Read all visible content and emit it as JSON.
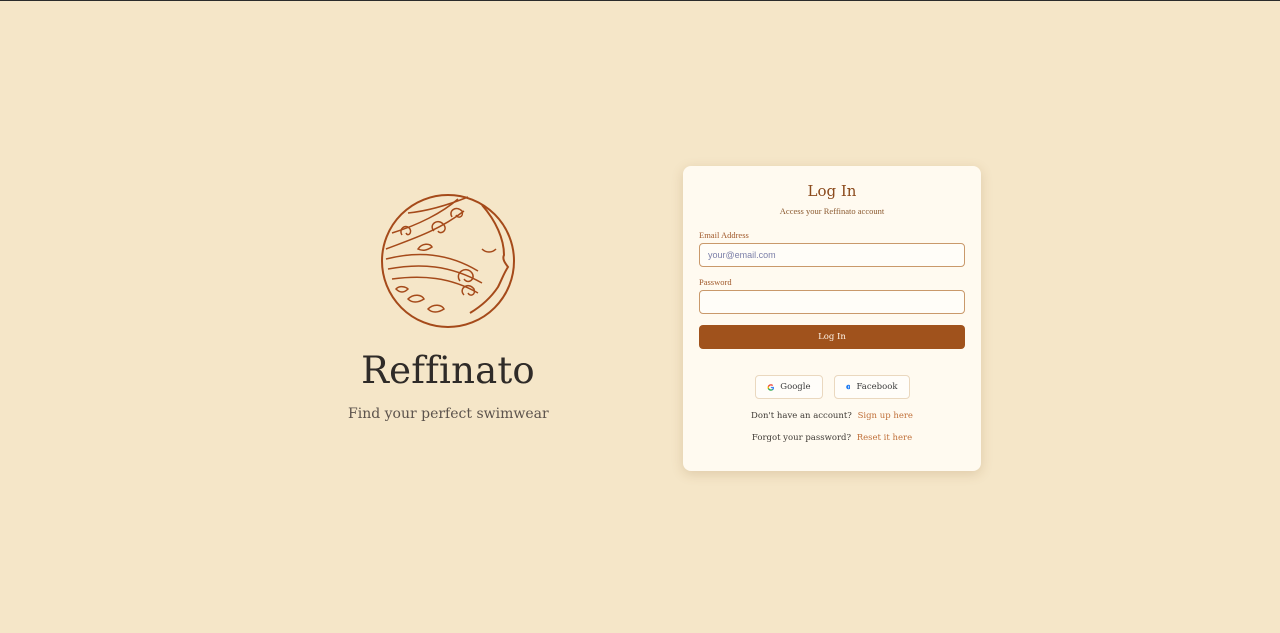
{
  "brand": {
    "name": "Reffinato",
    "tagline": "Find your perfect swimwear",
    "logo_icon": "woman-face-swirl-logo-icon"
  },
  "login_card": {
    "title": "Log In",
    "subtitle": "Access your Reffinato account",
    "email_label": "Email Address",
    "email_placeholder": "your@email.com",
    "email_value": "",
    "password_label": "Password",
    "password_value": "",
    "submit_label": "Log In",
    "social": [
      {
        "label": "Google",
        "icon": "google-icon"
      },
      {
        "label": "Facebook",
        "icon": "facebook-icon"
      }
    ],
    "signup_prompt": "Don't have an account?",
    "signup_link": "Sign up here",
    "forgot_prompt": "Forgot your password?",
    "forgot_link": "Reset it here"
  },
  "colors": {
    "background": "#f5e6c8",
    "card": "#fffaf0",
    "accent": "#a0521c",
    "logo": "#a54a1a"
  }
}
